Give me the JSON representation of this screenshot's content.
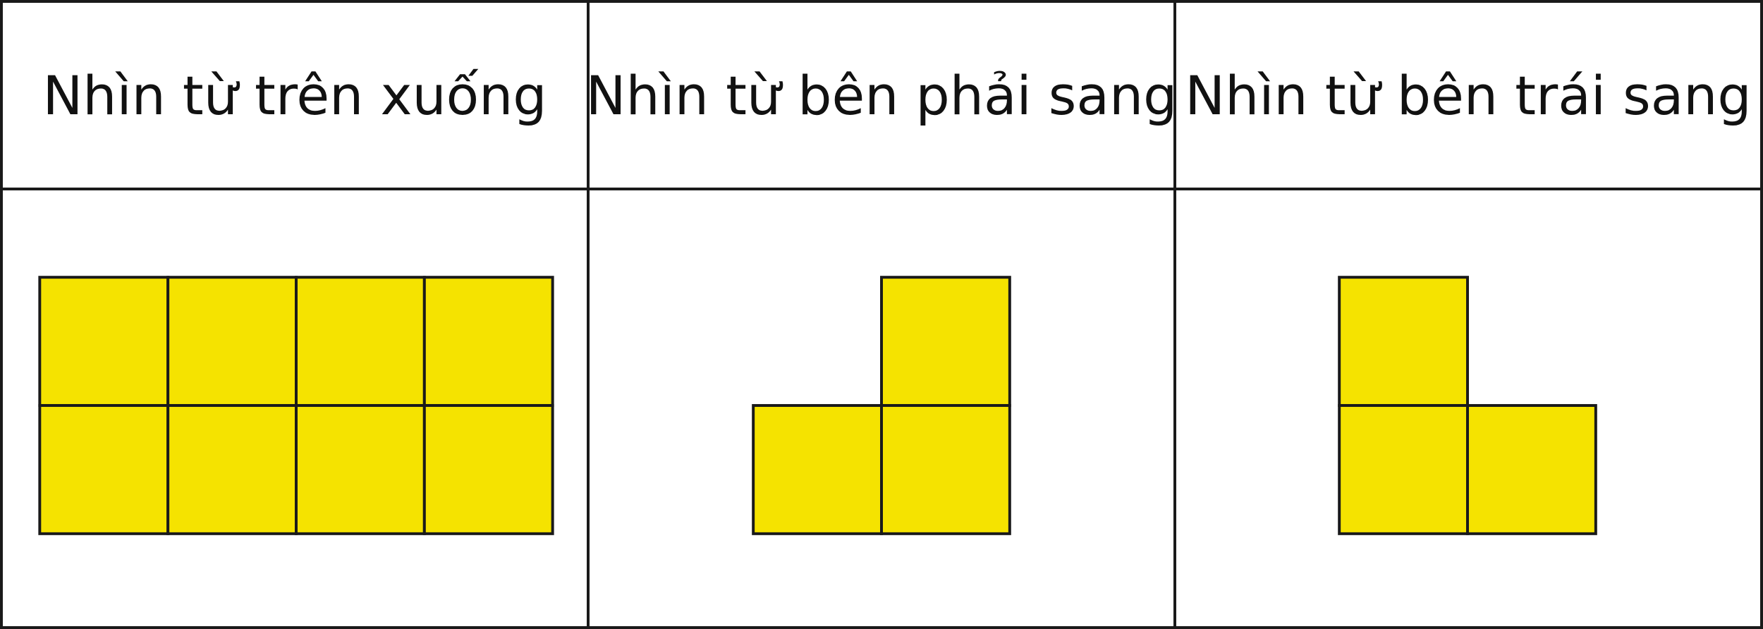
{
  "table": {
    "headers": [
      "Nhìn từ trên xuống",
      "Nhìn từ bên phải sang",
      "Nhìn từ bên trái sang"
    ],
    "square_color": "#f5e300",
    "line_color": "#1a1a1a",
    "views": [
      {
        "name": "top-view",
        "cells": [
          [
            0,
            0
          ],
          [
            1,
            0
          ],
          [
            2,
            0
          ],
          [
            3,
            0
          ],
          [
            0,
            1
          ],
          [
            1,
            1
          ],
          [
            2,
            1
          ],
          [
            3,
            1
          ]
        ]
      },
      {
        "name": "right-view",
        "cells": [
          [
            1,
            0
          ],
          [
            0,
            1
          ],
          [
            1,
            1
          ]
        ]
      },
      {
        "name": "left-view",
        "cells": [
          [
            0,
            0
          ],
          [
            0,
            1
          ],
          [
            1,
            1
          ]
        ]
      }
    ]
  }
}
